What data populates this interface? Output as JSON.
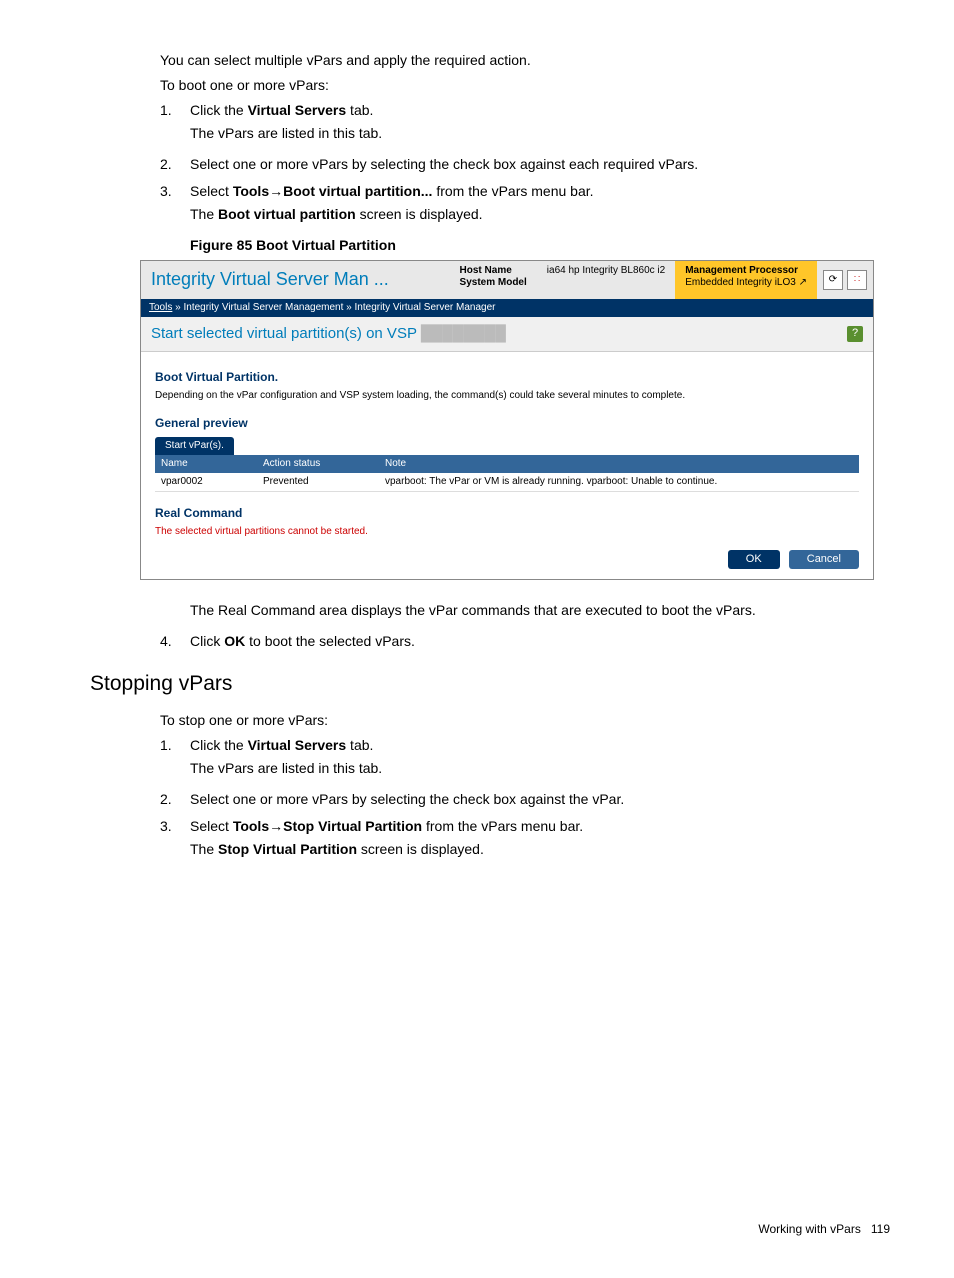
{
  "intro": {
    "line1": "You can select multiple vPars and apply the required action.",
    "line2": "To boot one or more vPars:"
  },
  "steps_boot": {
    "n1": "1.",
    "s1a": "Click the ",
    "s1b": "Virtual Servers",
    "s1c": " tab.",
    "s1sub": "The vPars are listed in this tab.",
    "n2": "2.",
    "s2": "Select one or more vPars by selecting the check box against each required vPars.",
    "n3": "3.",
    "s3a": "Select ",
    "s3b": "Tools",
    "s3arrow": "→",
    "s3c": "Boot virtual partition...",
    "s3d": " from the vPars menu bar.",
    "s3sub_a": "The ",
    "s3sub_b": "Boot virtual partition",
    "s3sub_c": " screen is displayed."
  },
  "figure_caption": "Figure 85 Boot Virtual Partition",
  "screenshot": {
    "title": "Integrity Virtual Server Man ...",
    "host_name_label": "Host Name",
    "host_name_value": "",
    "system_model_label": "System Model",
    "system_model_value": "ia64 hp Integrity BL860c i2",
    "mgmt_label": "Management Processor",
    "mgmt_value": "Embedded Integrity iLO3 ",
    "breadcrumb_tools": "Tools",
    "breadcrumb_sep": " » ",
    "breadcrumb_p1": "Integrity Virtual Server Management",
    "breadcrumb_p2": "Integrity Virtual Server Manager",
    "section_title": "Start selected virtual partition(s) on VSP",
    "boot_heading": "Boot Virtual Partition.",
    "boot_note": "Depending on the vPar configuration and VSP system loading, the command(s) could take several minutes to complete.",
    "general_preview": "General preview",
    "tab_label": "Start vPar(s).",
    "col_name": "Name",
    "col_status": "Action status",
    "col_note": "Note",
    "row_name": "vpar0002",
    "row_status": "Prevented",
    "row_note": "vparboot: The vPar or VM is already running. vparboot: Unable to continue.",
    "real_cmd": "Real Command",
    "real_cmd_msg": "The selected virtual partitions cannot be started.",
    "btn_ok": "OK",
    "btn_cancel": "Cancel"
  },
  "after_fig": {
    "line1": "The Real Command area displays the vPar commands that are executed to boot the vPars.",
    "n4": "4.",
    "s4a": "Click ",
    "s4b": "OK",
    "s4c": " to boot the selected vPars."
  },
  "stopping": {
    "heading": "Stopping vPars",
    "intro": "To stop one or more vPars:",
    "n1": "1.",
    "s1a": "Click the ",
    "s1b": "Virtual Servers",
    "s1c": " tab.",
    "s1sub": "The vPars are listed in this tab.",
    "n2": "2.",
    "s2": "Select one or more vPars by selecting the check box against the vPar.",
    "n3": "3.",
    "s3a": "Select ",
    "s3b": "Tools",
    "s3arrow": "→",
    "s3c": "Stop Virtual Partition",
    "s3d": " from the vPars menu bar.",
    "s3sub_a": "The ",
    "s3sub_b": "Stop Virtual Partition",
    "s3sub_c": " screen is displayed."
  },
  "footer": {
    "text": "Working with vPars",
    "page": "119"
  }
}
